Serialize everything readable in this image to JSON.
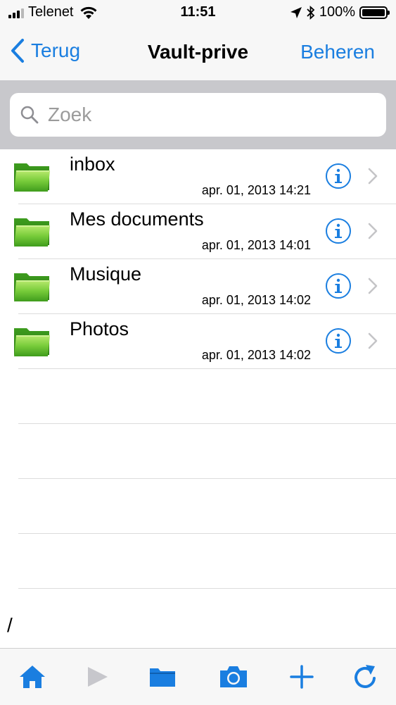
{
  "status_bar": {
    "carrier": "Telenet",
    "time": "11:51",
    "battery": "100%",
    "battery_level": 1.0
  },
  "nav": {
    "back_label": "Terug",
    "title": "Vault-prive",
    "manage_label": "Beheren"
  },
  "search": {
    "placeholder": "Zoek",
    "value": ""
  },
  "items": [
    {
      "name": "inbox",
      "date": "apr. 01, 2013 14:21"
    },
    {
      "name": "Mes documents",
      "date": "apr. 01, 2013 14:01"
    },
    {
      "name": "Musique",
      "date": "apr. 01, 2013 14:02"
    },
    {
      "name": "Photos",
      "date": "apr. 01, 2013 14:02"
    }
  ],
  "path": "/",
  "toolbar": {
    "icons": [
      "home-icon",
      "play-icon",
      "folder-icon",
      "camera-icon",
      "plus-icon",
      "refresh-icon"
    ]
  },
  "colors": {
    "accent": "#1a7ee0",
    "folder_green": "#5cbf2a",
    "search_background": "#c8c8cc"
  }
}
